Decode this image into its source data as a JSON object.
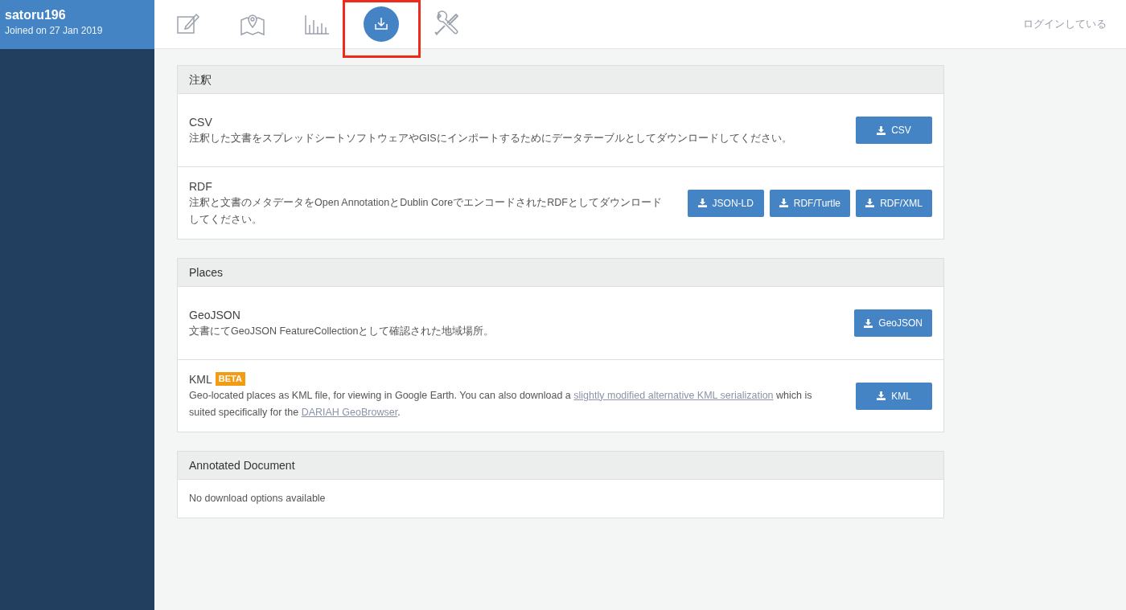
{
  "user": {
    "name": "satoru196",
    "joined": "Joined on 27 Jan 2019"
  },
  "tabs": [
    {
      "kind": "edit",
      "selected": false
    },
    {
      "kind": "map",
      "selected": false
    },
    {
      "kind": "chart",
      "selected": false
    },
    {
      "kind": "download",
      "selected": true
    },
    {
      "kind": "tools",
      "selected": false
    }
  ],
  "login_status": "ログインしている",
  "sections": [
    {
      "title": "注釈",
      "items": [
        {
          "name": "CSV",
          "description": [
            {
              "kind": "text",
              "text": "注釈した文書をスプレッドシートソフトウェアやGISにインポートするためにデータテーブルとしてダウンロードしてください。"
            }
          ],
          "buttons": [
            "CSV"
          ]
        },
        {
          "name": "RDF",
          "description": [
            {
              "kind": "text",
              "text": "注釈と文書のメタデータをOpen AnnotationとDublin CoreでエンコードされたRDFとしてダウンロードしてください。"
            }
          ],
          "buttons": [
            "JSON-LD",
            "RDF/Turtle",
            "RDF/XML"
          ]
        }
      ]
    },
    {
      "title": "Places",
      "items": [
        {
          "name": "GeoJSON",
          "description": [
            {
              "kind": "text",
              "text": "文書にてGeoJSON FeatureCollectionとして確認された地域場所。"
            }
          ],
          "buttons": [
            "GeoJSON"
          ]
        },
        {
          "name": "KML",
          "badge": "BETA",
          "description": [
            {
              "kind": "text",
              "text": "Geo-located places as KML file, for viewing in Google Earth. You can also download a "
            },
            {
              "kind": "link",
              "text": "slightly modified alternative KML serialization"
            },
            {
              "kind": "text",
              "text": " which is suited specifically for the "
            },
            {
              "kind": "link",
              "text": "DARIAH GeoBrowser"
            },
            {
              "kind": "text",
              "text": "."
            }
          ],
          "buttons": [
            "KML"
          ]
        }
      ]
    },
    {
      "title": "Annotated Document",
      "empty_message": "No download options available"
    }
  ]
}
